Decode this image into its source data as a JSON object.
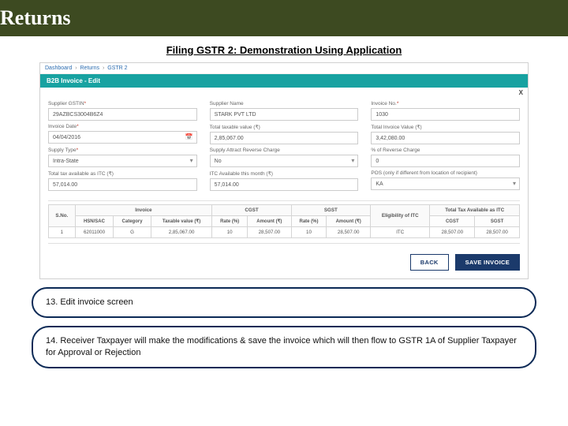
{
  "banner": {
    "title": "Returns"
  },
  "subtitle": "Filing GSTR 2: Demonstration Using Application",
  "breadcrumb": {
    "a": "Dashboard",
    "b": "Returns",
    "c": "GSTR 2"
  },
  "panel": {
    "title": "B2B Invoice - Edit",
    "close": "X"
  },
  "fields": {
    "gstin": {
      "label": "Supplier GSTIN",
      "req": "*",
      "value": "29AZBCS3004B6Z4"
    },
    "sname": {
      "label": "Supplier Name",
      "value": "STARK PVT LTD"
    },
    "invno": {
      "label": "Invoice No.",
      "req": "*",
      "value": "1030"
    },
    "invdate": {
      "label": "Invoice Date",
      "req": "*",
      "value": "04/04/2016"
    },
    "taxable": {
      "label": "Total taxable value (₹)",
      "value": "2,85,067.00"
    },
    "invval": {
      "label": "Total Invoice Value (₹)",
      "value": "3,42,080.00"
    },
    "stype": {
      "label": "Supply Type",
      "req": "*",
      "value": "Intra-State"
    },
    "revchg": {
      "label": "Supply Attract Reverse Charge",
      "value": "No"
    },
    "pctrev": {
      "label": "% of Reverse Charge",
      "value": "0"
    },
    "totitc": {
      "label": "Total tax available as ITC (₹)",
      "value": "57,014.00"
    },
    "itcmonth": {
      "label": "ITC Available this month (₹)",
      "value": "57,014.00"
    },
    "pos": {
      "label": "POS (only if different from location of recipient)",
      "value": "KA"
    }
  },
  "table": {
    "h": {
      "sno": "S.No.",
      "inv": "Invoice",
      "cgst": "CGST",
      "sgst": "SGST",
      "elig": "Eligibility of ITC",
      "itc": "Total Tax Available as ITC",
      "hsn": "HSN/SAC",
      "cat": "Category",
      "txv": "Taxable value (₹)",
      "rate": "Rate (%)",
      "amt": "Amount (₹)"
    },
    "row": {
      "sno": "1",
      "hsn": "62011000",
      "cat": "G",
      "txv": "2,85,067.00",
      "crate": "10",
      "camt": "28,507.00",
      "srate": "10",
      "samt": "28,507.00",
      "elig": "ITC",
      "egst": "28,507.00",
      "esgst": "28,507.00"
    }
  },
  "buttons": {
    "back": "BACK",
    "save": "SAVE INVOICE"
  },
  "callouts": {
    "c13": "13. Edit invoice screen",
    "c14": "14. Receiver Taxpayer will make the modifications & save the invoice which will then flow to GSTR 1A of Supplier Taxpayer for Approval or Rejection"
  }
}
